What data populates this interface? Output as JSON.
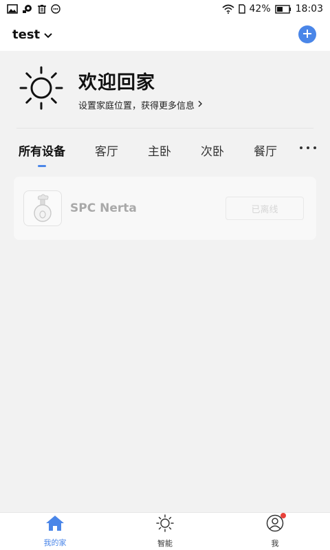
{
  "status_bar": {
    "battery": "42%",
    "time": "18:03",
    "icons_left": [
      "image-icon",
      "cast-icon",
      "trash-icon",
      "chat-icon"
    ],
    "icons_right": [
      "wifi-icon",
      "sim-icon",
      "battery-icon"
    ]
  },
  "header": {
    "home_name": "test",
    "add_icon": "plus-icon"
  },
  "welcome": {
    "title": "欢迎回家",
    "subtitle": "设置家庭位置，获得更多信息",
    "icon": "sun-icon"
  },
  "room_tabs": [
    {
      "label": "所有设备",
      "active": true
    },
    {
      "label": "客厅",
      "active": false
    },
    {
      "label": "主卧",
      "active": false
    },
    {
      "label": "次卧",
      "active": false
    },
    {
      "label": "餐厅",
      "active": false
    }
  ],
  "devices": [
    {
      "name": "SPC Nerta",
      "status": "已离线",
      "icon": "humidifier-icon"
    }
  ],
  "bottom_nav": [
    {
      "label": "我的家",
      "icon": "home-icon",
      "active": true
    },
    {
      "label": "智能",
      "icon": "sun-icon",
      "active": false
    },
    {
      "label": "我",
      "icon": "user-icon",
      "active": false,
      "badge": true
    }
  ],
  "colors": {
    "accent": "#4a86e8",
    "background": "#f2f2f2",
    "badge": "#e8413a"
  }
}
